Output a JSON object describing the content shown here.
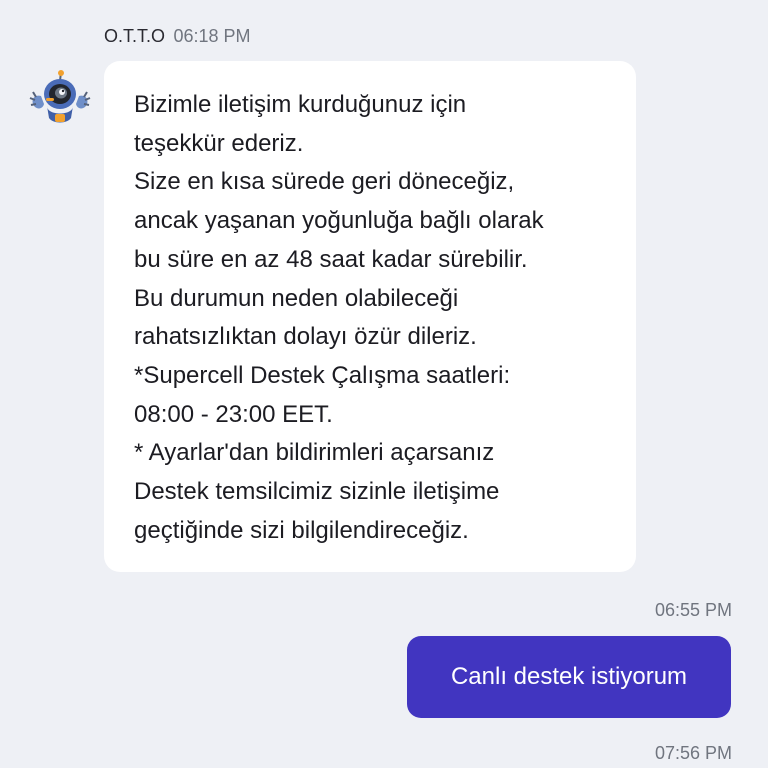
{
  "bot_message": {
    "sender": "O.T.T.O",
    "time": "06:18 PM",
    "avatar_icon": "robot-avatar-icon",
    "lines": [
      "Bizimle iletişim kurduğunuz için",
      "teşekkür ederiz.",
      "Size en kısa sürede geri döneceğiz,",
      "ancak yaşanan yoğunluğa bağlı olarak",
      "bu süre en az 48 saat kadar sürebilir.",
      "Bu durumun neden olabileceği",
      "rahatsızlıktan dolayı özür dileriz.",
      "*Supercell Destek Çalışma saatleri:",
      "08:00 - 23:00 EET.",
      "* Ayarlar'dan bildirimleri açarsanız",
      "Destek temsilcimiz sizinle iletişime",
      "geçtiğinde sizi bilgilendireceğiz."
    ]
  },
  "user_message": {
    "time": "06:55 PM",
    "text": "Canlı destek istiyorum"
  },
  "next_time": "07:56 PM",
  "colors": {
    "background": "#eef0f5",
    "bubble_bot": "#ffffff",
    "bubble_user": "#4135c0",
    "text_primary": "#1c1c22",
    "text_muted": "#70757f"
  }
}
